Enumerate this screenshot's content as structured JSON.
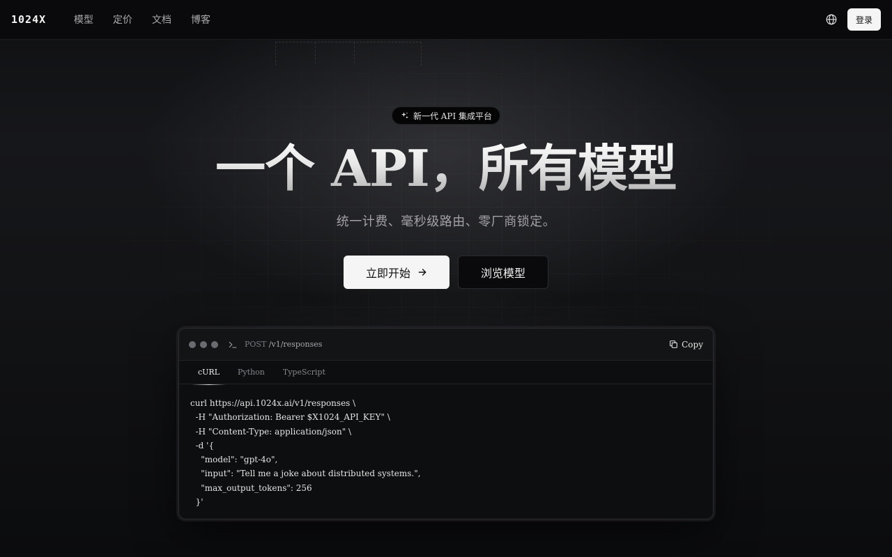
{
  "nav": {
    "logo": "1024X",
    "links": [
      "模型",
      "定价",
      "文档",
      "博客"
    ],
    "globe_icon": "globe-icon",
    "login_label": "登录"
  },
  "hero": {
    "badge_icon": "sparkle-icon",
    "badge_text": "新一代 API 集成平台",
    "title": "一个 API，所有模型",
    "subtitle": "统一计费、毫秒级路由、零厂商锁定。",
    "primary_cta": "立即开始",
    "primary_cta_icon": "arrow-right-icon",
    "secondary_cta": "浏览模型"
  },
  "code_window": {
    "method": "POST",
    "path": "/v1/responses",
    "copy_label": "Copy",
    "tabs": [
      "cURL",
      "Python",
      "TypeScript"
    ],
    "active_tab": "cURL",
    "lines": [
      "curl https://api.1024x.ai/v1/responses \\",
      "  -H \"Authorization: Bearer $X1024_API_KEY\" \\",
      "  -H \"Content-Type: application/json\" \\",
      "  -d '{",
      "    \"model\": \"gpt-4o\",",
      "    \"input\": \"Tell me a joke about distributed systems.\",",
      "    \"max_output_tokens\": 256",
      "  }'"
    ]
  },
  "colors": {
    "background": "#0b0c0e",
    "primary_button": "#f5f5f5",
    "muted_text": "#a2a2a6"
  }
}
